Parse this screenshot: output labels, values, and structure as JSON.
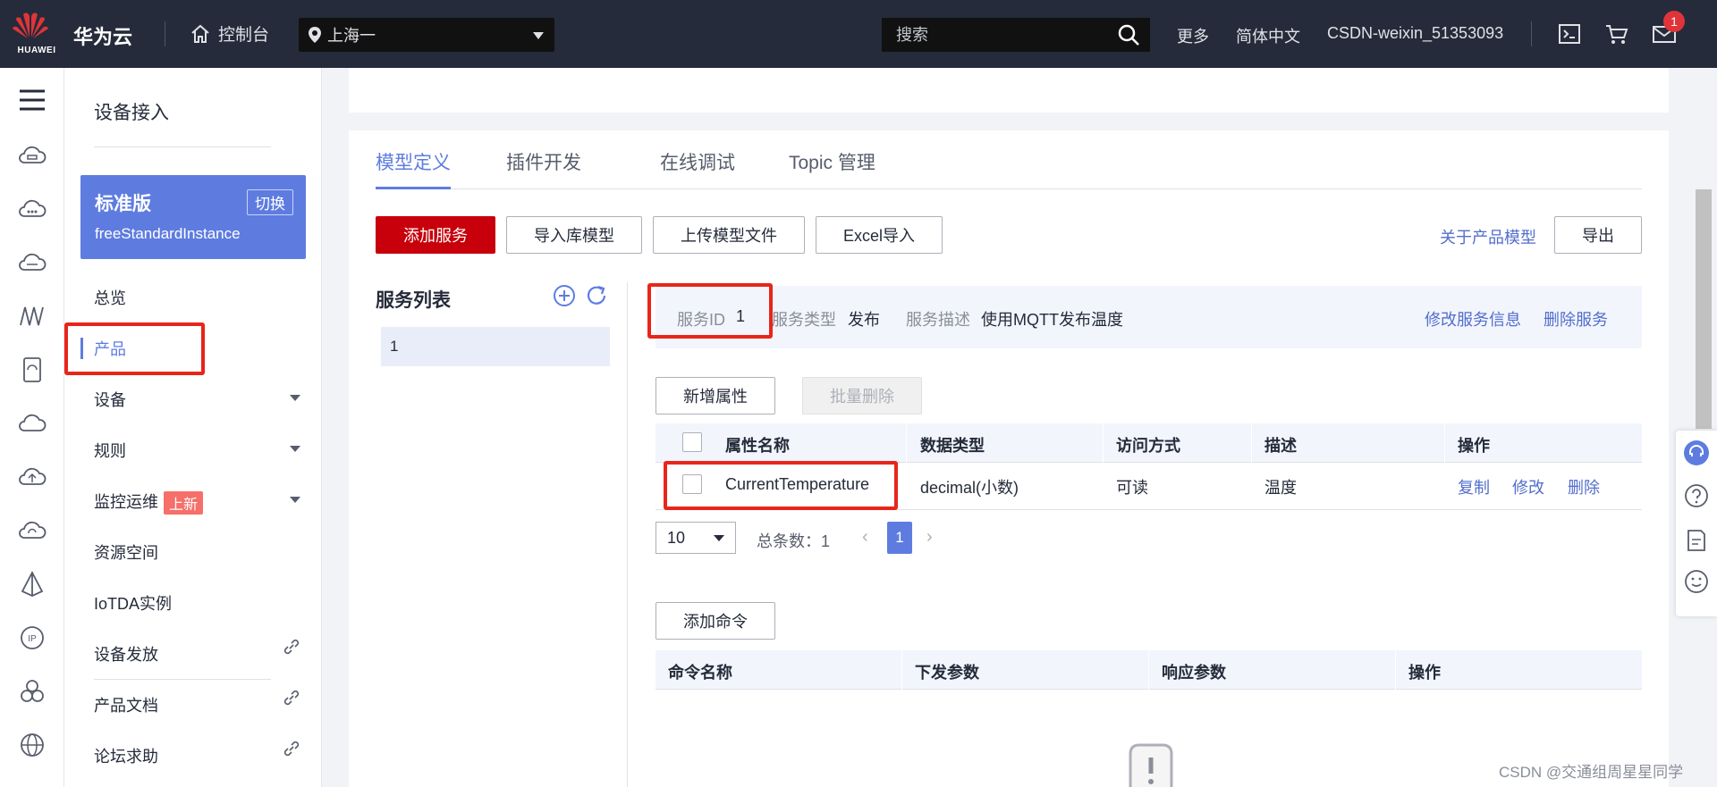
{
  "header": {
    "logo_text": "HUAWEI",
    "brand": "华为云",
    "console": "控制台",
    "region": "上海一",
    "search_placeholder": "搜索",
    "more": "更多",
    "language": "简体中文",
    "user": "CSDN-weixin_51353093",
    "mail_badge": "1"
  },
  "side": {
    "title": "设备接入",
    "edition_name": "标准版",
    "edition_switch": "切换",
    "edition_instance": "freeStandardInstance",
    "items": [
      {
        "label": "总览"
      },
      {
        "label": "产品"
      },
      {
        "label": "设备"
      },
      {
        "label": "规则"
      },
      {
        "label": "监控运维",
        "tag": "上新"
      },
      {
        "label": "资源空间"
      },
      {
        "label": "IoTDA实例"
      },
      {
        "label": "设备发放"
      },
      {
        "label": "产品文档"
      },
      {
        "label": "论坛求助"
      }
    ]
  },
  "main": {
    "tabs": [
      {
        "label": "模型定义",
        "active": true
      },
      {
        "label": "插件开发"
      },
      {
        "label": "在线调试"
      },
      {
        "label": "Topic 管理"
      }
    ],
    "toolbar": {
      "add_service": "添加服务",
      "import_library": "导入库模型",
      "upload_model": "上传模型文件",
      "excel_import": "Excel导入",
      "about_model": "关于产品模型",
      "export": "导出"
    },
    "service_list": {
      "title": "服务列表",
      "items": [
        "1"
      ]
    },
    "service_info": {
      "id_label": "服务ID",
      "id_value": "1",
      "type_label": "服务类型",
      "type_value": "发布",
      "desc_label": "服务描述",
      "desc_value": "使用MQTT发布温度",
      "edit": "修改服务信息",
      "delete": "删除服务"
    },
    "properties": {
      "add": "新增属性",
      "batch_delete": "批量删除",
      "columns": [
        "属性名称",
        "数据类型",
        "访问方式",
        "描述",
        "操作"
      ],
      "rows": [
        {
          "name": "CurrentTemperature",
          "type": "decimal(小数)",
          "access": "可读",
          "desc": "温度",
          "actions": [
            "复制",
            "修改",
            "删除"
          ]
        }
      ]
    },
    "pagination": {
      "page_size": "10",
      "total_label": "总条数：",
      "total": "1",
      "current": "1"
    },
    "commands": {
      "add": "添加命令",
      "columns": [
        "命令名称",
        "下发参数",
        "响应参数",
        "操作"
      ]
    }
  },
  "watermark": "CSDN @交通组周星星同学",
  "colors": {
    "topbar": "#252b3a",
    "accent": "#5e7ce0",
    "primary_button": "#c7000b",
    "highlight_box": "#e8251a"
  }
}
